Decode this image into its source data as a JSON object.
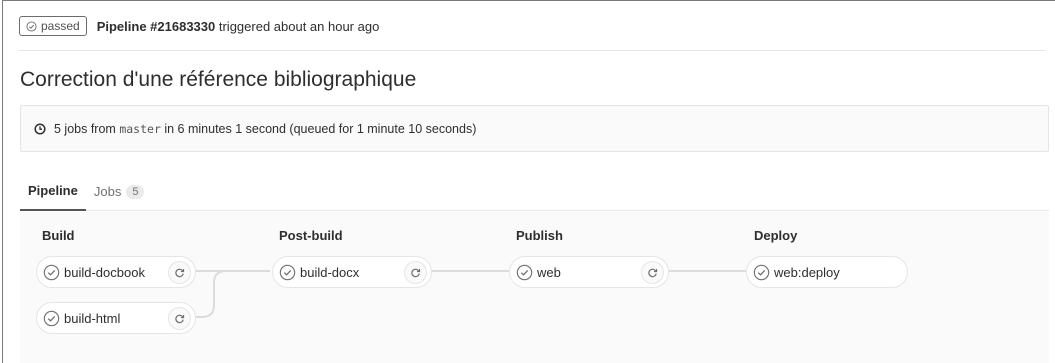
{
  "header": {
    "status": "passed",
    "pipeline_label": "Pipeline #21683330",
    "triggered_text": "triggered about an hour ago"
  },
  "title": "Correction d'une référence bibliographique",
  "info": {
    "prefix": "5 jobs from",
    "branch": "master",
    "suffix": "in 6 minutes 1 second (queued for 1 minute 10 seconds)"
  },
  "tabs": {
    "pipeline": "Pipeline",
    "jobs": "Jobs",
    "jobs_count": "5"
  },
  "stages": [
    {
      "name": "Build",
      "jobs": [
        "build-docbook",
        "build-html"
      ]
    },
    {
      "name": "Post-build",
      "jobs": [
        "build-docx"
      ]
    },
    {
      "name": "Publish",
      "jobs": [
        "web"
      ]
    },
    {
      "name": "Deploy",
      "jobs": [
        "web:deploy"
      ]
    }
  ],
  "colors": {
    "success": "#1aaa55",
    "border": "#e5e5e5"
  }
}
